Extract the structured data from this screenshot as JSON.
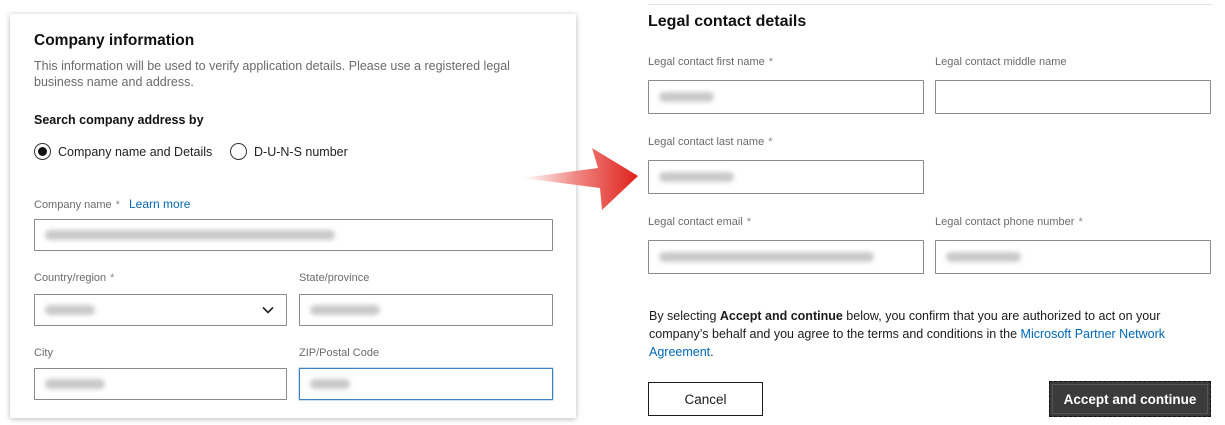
{
  "company_card": {
    "title": "Company information",
    "description": "This information will be used to verify application details. Please use a registered legal business name and address.",
    "search_heading": "Search company address by",
    "search_options": [
      {
        "label": "Company name and Details",
        "selected": true
      },
      {
        "label": "D-U-N-S number",
        "selected": false
      }
    ],
    "company_name": {
      "label": "Company name",
      "required_mark": "*",
      "learn_more": "Learn more"
    },
    "country": {
      "label": "Country/region",
      "required_mark": "*"
    },
    "state": {
      "label": "State/province"
    },
    "city": {
      "label": "City"
    },
    "zip": {
      "label": "ZIP/Postal Code"
    }
  },
  "legal_contact": {
    "title": "Legal contact details",
    "first_name": {
      "label": "Legal contact first name",
      "required_mark": "*"
    },
    "middle_name": {
      "label": "Legal contact middle name"
    },
    "last_name": {
      "label": "Legal contact last name",
      "required_mark": "*"
    },
    "email": {
      "label": "Legal contact email",
      "required_mark": "*"
    },
    "phone": {
      "label": "Legal contact phone number",
      "required_mark": "*"
    },
    "terms": {
      "prefix": "By selecting ",
      "bold": "Accept and continue",
      "middle": " below, you confirm that you are authorized to act on your company’s behalf and you agree to the terms and conditions in the ",
      "link": "Microsoft Partner Network Agreement",
      "suffix": "."
    },
    "cancel_label": "Cancel",
    "accept_label": "Accept and continue"
  },
  "colors": {
    "link": "#0067b8",
    "arrow": "#e0201b",
    "accept_bg": "#3b3b3b",
    "focus_border": "#3b7fc4"
  },
  "icons": {
    "dropdown": "chevron-down-icon",
    "arrow": "arrow-right-icon"
  }
}
